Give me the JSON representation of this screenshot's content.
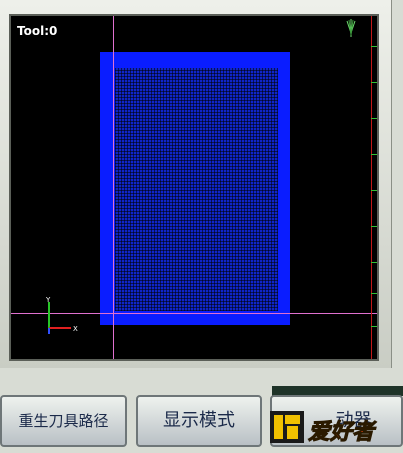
{
  "viewport": {
    "tool_label": "Tool:0",
    "axis_y": "Y",
    "axis_x": "X"
  },
  "buttons": {
    "regen_path": "重生刀具路径",
    "display_mode": "显示模式",
    "controller": "动器"
  },
  "watermark": {
    "text": "爱好者"
  },
  "colors": {
    "part_outer": "#0a1dff",
    "part_inner": "#0f25c9",
    "crosshair": "#e070d0",
    "limit_line": "#c01818",
    "ticks": "#35c035"
  }
}
